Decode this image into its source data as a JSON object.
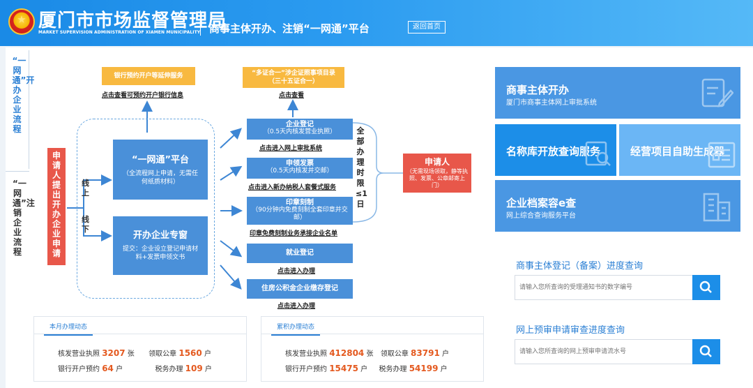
{
  "header": {
    "org_name": "厦门市市场监督管理局",
    "org_en": "MARKET SUPERVISION ADMINISTRATION OF XIAMEN MUNICIPALITY",
    "platform_title": "商事主体开办、注销“一网通”平台",
    "home_button": "返回首页"
  },
  "side_tabs": {
    "tab1": "“一网通”开办企业流程",
    "tab2": "“一网通”注销企业流程"
  },
  "flow": {
    "bank_box": "银行预约开户等延伸服务",
    "bank_link": "点击查看可预约开户银行信息",
    "catalog_box_line1": "“多证合一”涉企证照事项目录",
    "catalog_box_line2": "（三十五证合一）",
    "catalog_link": "点击查看",
    "applicant_left": "申请人提出开办企业申请",
    "online_label": "线上",
    "offline_label": "线下",
    "platform_title": "“一网通”平台",
    "platform_desc": "（全流程网上申请，无需任何纸质材料）",
    "counter_title": "开办企业专窗",
    "counter_desc": "提交：企业设立登记申请材料+发票申领文书",
    "step1_title": "企业登记",
    "step1_desc": "（0.5天内核发营业执照）",
    "step1_link": "点击进入网上审批系统",
    "step2_title": "申领发票",
    "step2_desc": "（0.5天内核发并交邮）",
    "step2_link": "点击进入新办纳税人套餐式服务",
    "step3_title": "印章刻制",
    "step3_desc": "（90分钟内免费刻制全套印章并交邮）",
    "step3_link": "印章免费刻制业务承接企业名单",
    "step4_title": "就业登记",
    "step4_link": "点击进入办理",
    "step5_title": "住房公积金企业缴存登记",
    "step5_link": "点击进入办理",
    "time_limit": "全部办理时限≤1日",
    "applicant_right_title": "申请人",
    "applicant_right_desc": "（无需现场领取，静等执照、发票、公章邮寄上门）"
  },
  "stats_month": {
    "tab": "本月办理动态",
    "license_label": "核发营业执照",
    "license_value": "3207",
    "license_unit": "张",
    "seal_label": "领取公章",
    "seal_value": "1560",
    "seal_unit": "户",
    "bank_label": "银行开户预约",
    "bank_value": "64",
    "bank_unit": "户",
    "tax_label": "税务办理",
    "tax_value": "109",
    "tax_unit": "户"
  },
  "stats_total": {
    "tab": "累积办理动态",
    "license_label": "核发营业执照",
    "license_value": "412804",
    "license_unit": "张",
    "seal_label": "领取公章",
    "seal_value": "83791",
    "seal_unit": "户",
    "bank_label": "银行开户预约",
    "bank_value": "15475",
    "bank_unit": "户",
    "tax_label": "税务办理",
    "tax_value": "54199",
    "tax_unit": "户"
  },
  "services": {
    "s1_title": "商事主体开办",
    "s1_sub": "厦门市商事主体网上审批系统",
    "s2_title": "名称库开放查询服务",
    "s3_title": "经营项目自助生成器",
    "s4_title": "企业档案容e查",
    "s4_sub": "网上综合查询服务平台"
  },
  "queries": {
    "q1_title": "商事主体登记（备案）进度查询",
    "q1_placeholder": "请输入您所查询的受理通知书的数字编号",
    "q2_title": "网上预审申请审查进度查询",
    "q2_placeholder": "请输入您所查询的网上预审申请流水号"
  },
  "colors": {
    "brand_blue": "#2b9bf0",
    "flow_blue": "#4a90d9",
    "accent_orange": "#f8b940",
    "applicant_red": "#e8574a",
    "stat_number": "#e45a20"
  }
}
